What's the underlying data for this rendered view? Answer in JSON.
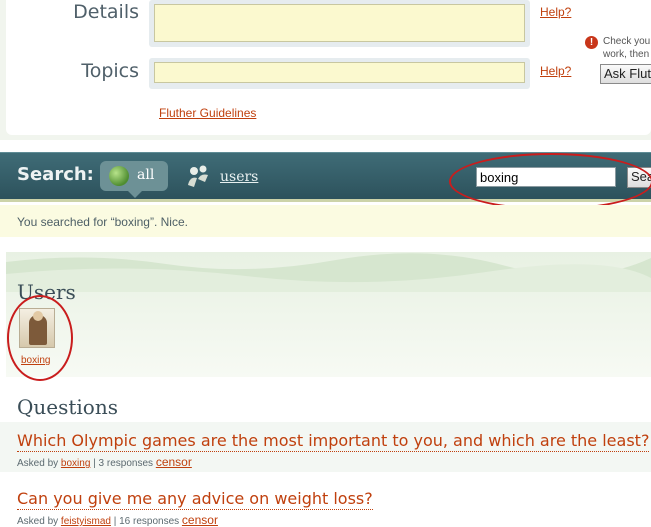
{
  "ask_form": {
    "details_label": "Details",
    "topics_label": "Topics",
    "help_link": "Help?",
    "notice_line1": "Check you",
    "notice_line2": "work, then",
    "ask_button": "Ask Flut",
    "guidelines_link": "Fluther Guidelines"
  },
  "search": {
    "label": "Search:",
    "tab_all": "all",
    "tab_users": "users",
    "query": "boxing",
    "button": "Sea",
    "result_message": "You searched for “boxing”. Nice."
  },
  "users_section": {
    "title": "Users",
    "users": [
      {
        "name": "boxing"
      }
    ]
  },
  "questions_section": {
    "title": "Questions",
    "items": [
      {
        "title": "Which Olympic games are the most important to you, and which are the least?",
        "asked_by_prefix": "Asked by",
        "author": "boxing",
        "responses": "| 3 responses",
        "censor": "censor"
      },
      {
        "title": "Can you give me any advice on weight loss?",
        "asked_by_prefix": "Asked by",
        "author": "feistyismad",
        "responses": "| 16 responses",
        "censor": "censor"
      }
    ]
  },
  "colors": {
    "link": "#c0400e",
    "search_bar": "#2d525c",
    "annotation": "#c91d1d"
  }
}
